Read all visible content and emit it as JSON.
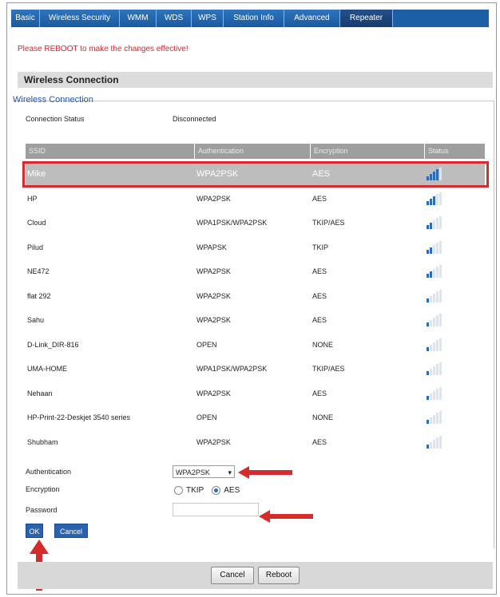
{
  "tabs": [
    "Basic",
    "Wireless Security",
    "WMM",
    "WDS",
    "WPS",
    "Station Info",
    "Advanced",
    "Repeater"
  ],
  "notice": "Please REBOOT to make the changes effective!",
  "section_title": "Wireless Connection",
  "fieldset_legend": "Wireless Connection",
  "connection": {
    "label": "Connection Status",
    "value": "Disconnected"
  },
  "table": {
    "headers": [
      "SSID",
      "Authentication",
      "Encryption",
      "Status"
    ],
    "rows": [
      {
        "ssid": "Mike",
        "auth": "WPA2PSK",
        "enc": "AES",
        "signal": 4
      },
      {
        "ssid": "HP",
        "auth": "WPA2PSK",
        "enc": "AES",
        "signal": 3
      },
      {
        "ssid": "Cloud",
        "auth": "WPA1PSK/WPA2PSK",
        "enc": "TKIP/AES",
        "signal": 2
      },
      {
        "ssid": "Pilud",
        "auth": "WPAPSK",
        "enc": "TKIP",
        "signal": 2
      },
      {
        "ssid": "NE472",
        "auth": "WPA2PSK",
        "enc": "AES",
        "signal": 2
      },
      {
        "ssid": "flat 292",
        "auth": "WPA2PSK",
        "enc": "AES",
        "signal": 1
      },
      {
        "ssid": "Sahu",
        "auth": "WPA2PSK",
        "enc": "AES",
        "signal": 1
      },
      {
        "ssid": "D-Link_DIR-816",
        "auth": "OPEN",
        "enc": "NONE",
        "signal": 1
      },
      {
        "ssid": "UMA-HOME",
        "auth": "WPA1PSK/WPA2PSK",
        "enc": "TKIP/AES",
        "signal": 1
      },
      {
        "ssid": "Nehaan",
        "auth": "WPA2PSK",
        "enc": "AES",
        "signal": 1
      },
      {
        "ssid": "HP-Print-22-Deskjet 3540 series",
        "auth": "OPEN",
        "enc": "NONE",
        "signal": 1
      },
      {
        "ssid": "Shubham",
        "auth": "WPA2PSK",
        "enc": "AES",
        "signal": 1
      }
    ]
  },
  "form": {
    "auth_label": "Authentication",
    "auth_value": "WPA2PSK",
    "enc_label": "Encryption",
    "enc_options": [
      "TKIP",
      "AES"
    ],
    "enc_selected": "AES",
    "pw_label": "Password",
    "pw_value": ""
  },
  "buttons": {
    "ok": "OK",
    "cancel": "Cancel",
    "bottom_cancel": "Cancel",
    "reboot": "Reboot"
  },
  "colors": {
    "accent": "#2b62b0",
    "notice": "#e02424",
    "highlight": "#d62b2b"
  }
}
